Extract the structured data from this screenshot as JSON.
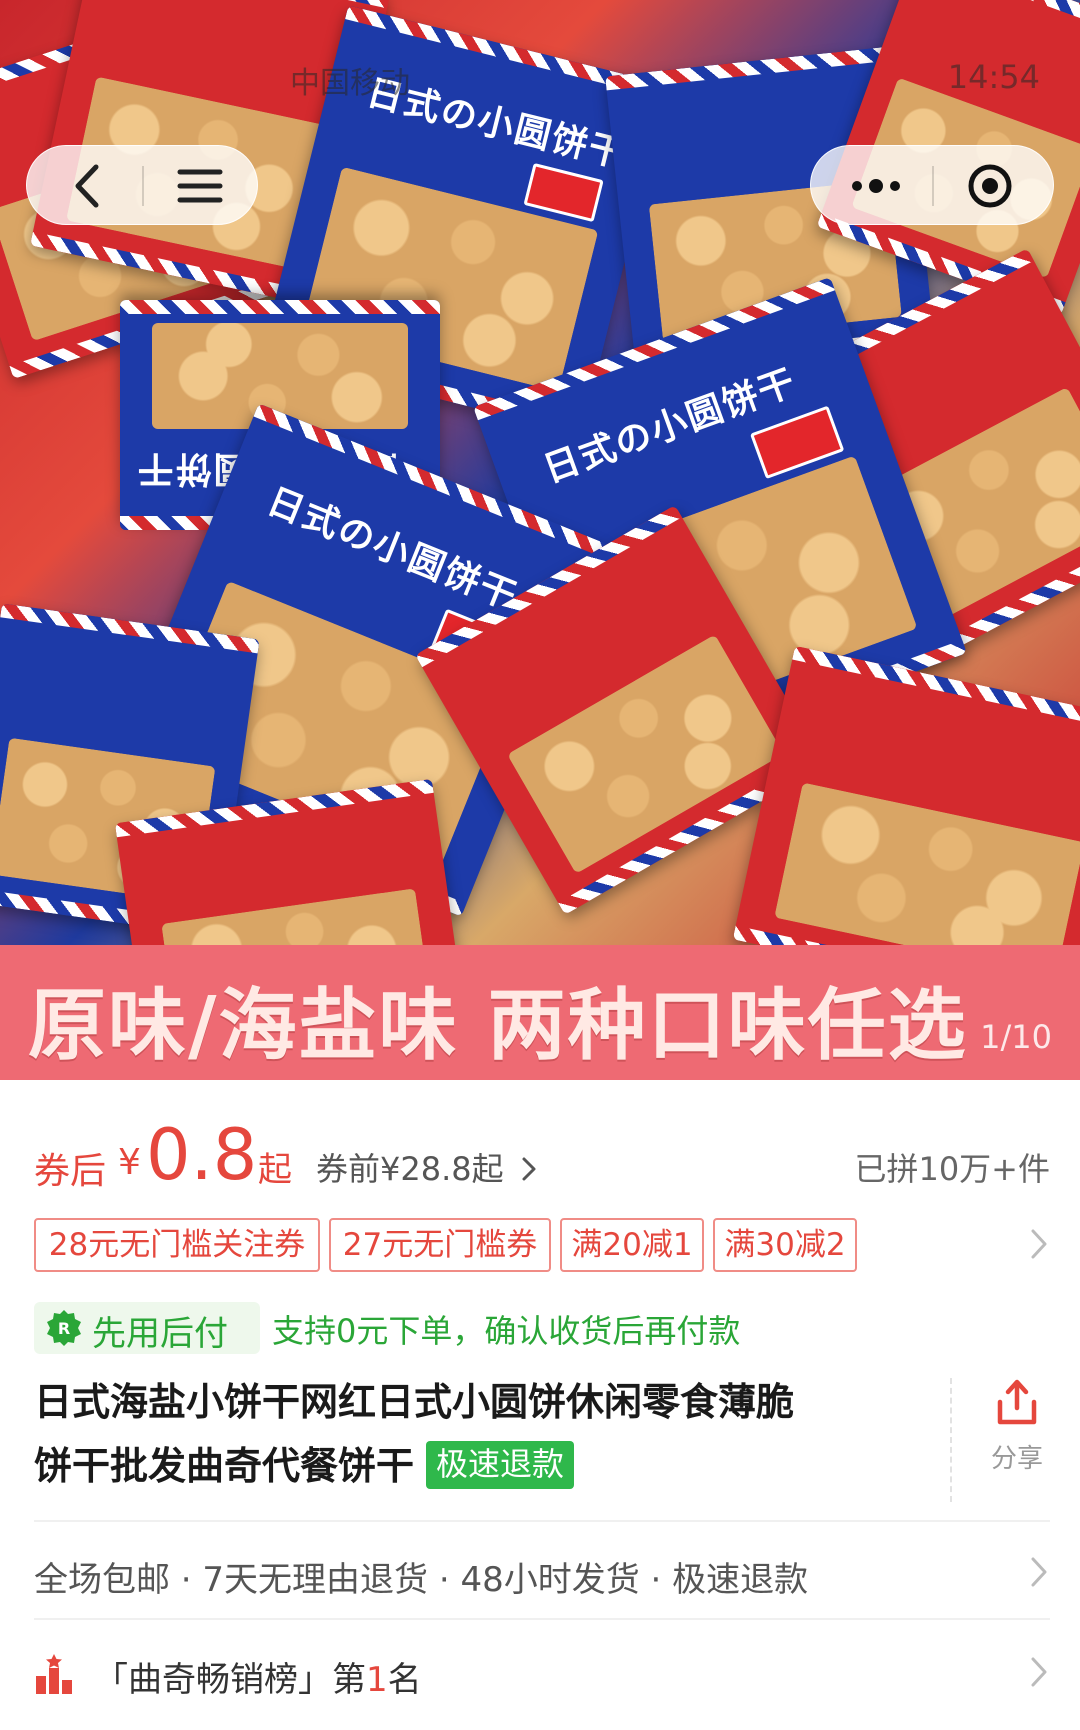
{
  "status_bar": {
    "carrier": "中国移动",
    "time": "14:54"
  },
  "gallery": {
    "banner_text": "原味/海盐味 两种口味任选",
    "counter": "1/10",
    "bag_label": "日式の小圆饼干"
  },
  "price": {
    "coupon_after_label": "券后",
    "currency": "¥",
    "value": "0.8",
    "suffix": "起",
    "original": "券前¥28.8起",
    "sold": "已拼10万+件"
  },
  "coupons": [
    "28元无门槛关注券",
    "27元无门槛券",
    "满20减1",
    "满30减2"
  ],
  "pay_later": {
    "label": "先用后付",
    "description": "支持0元下单，确认收货后再付款"
  },
  "title": {
    "line1": "日式海盐小饼干网红日式小圆饼休闲零食薄脆",
    "line2": "饼干批发曲奇代餐饼干",
    "badge": "极速退款"
  },
  "share": {
    "label": "分享"
  },
  "services": "全场包邮 · 7天无理由退货 · 48小时发货 · 极速退款",
  "rank": {
    "prefix": "「曲奇畅销榜」第",
    "number": "1",
    "suffix": "名"
  },
  "colors": {
    "price_red": "#e5473d",
    "banner_pink": "#ee6a73",
    "pay_green": "#2aa637",
    "refund_green": "#2fb84b"
  }
}
